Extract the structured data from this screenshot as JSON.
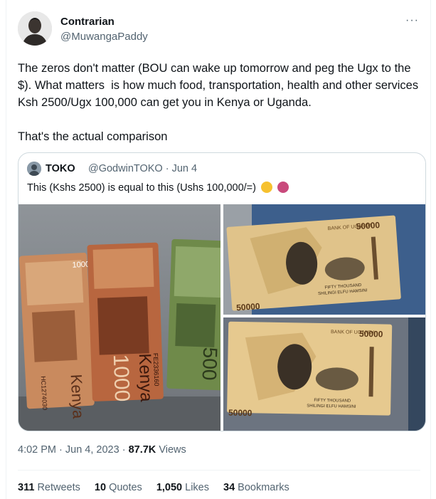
{
  "tweet": {
    "display_name": "Contrarian",
    "handle": "@MuwangaPaddy",
    "more_icon": "more-horizontal-icon",
    "text_paragraph_1": "The zeros don't matter (BOU can wake up tomorrow and peg the Ugx to the $). What matters  is how much food, transportation, health and other services Ksh 2500/Ugx 100,000 can get you in Kenya or Uganda.",
    "text_paragraph_2": "That's the actual comparison",
    "time": "4:02 PM",
    "date": "Jun 4, 2023",
    "views_count": "87.7K",
    "views_label": "Views",
    "stats": {
      "retweets_count": "311",
      "retweets_label": "Retweets",
      "quotes_count": "10",
      "quotes_label": "Quotes",
      "likes_count": "1,050",
      "likes_label": "Likes",
      "bookmarks_count": "34",
      "bookmarks_label": "Bookmarks"
    }
  },
  "quoted_tweet": {
    "display_name": "TOKO",
    "handle": "@GodwinTOKO",
    "date": "Jun 4",
    "text": "This (Kshs 2500) is equal to this (Ushs 100,000/=)",
    "images": {
      "left": {
        "note_1_serial": "HC1274030",
        "note_1_value": "1000",
        "note_1_country": "Kenya",
        "note_2_serial": "FE2336160",
        "note_2_value": "1000",
        "note_2_country": "Kenya",
        "note_3_value": "500"
      },
      "right_top": {
        "bank_name": "BANK OF UGANDA",
        "value_top": "50000",
        "value_side": "50000",
        "value_words": "FIFTY THOUSAND",
        "value_words_local": "SHILINGI ELFU HAMSINI"
      },
      "right_bottom": {
        "bank_name": "BANK OF UGANDA",
        "value_top": "50000",
        "value_side": "50000",
        "value_words": "FIFTY THOUSAND",
        "value_words_local": "SHILINGI ELFU HAMSINI"
      }
    }
  },
  "colors": {
    "text_primary": "#0f1419",
    "text_secondary": "#536471",
    "border": "#cfd9de"
  }
}
